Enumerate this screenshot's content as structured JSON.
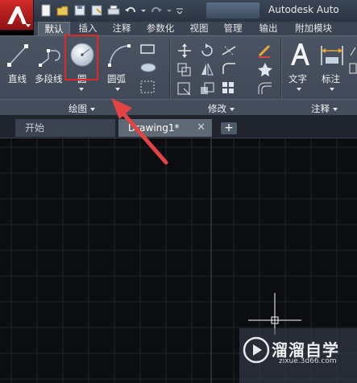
{
  "title_bar": {
    "app_title": "Autodesk Auto"
  },
  "ribbon_tabs": [
    "默认",
    "插入",
    "注释",
    "参数化",
    "视图",
    "管理",
    "输出",
    "附加模块"
  ],
  "ribbon": {
    "draw": {
      "line": "直线",
      "polyline": "多段线",
      "circle": "圆",
      "arc": "圆弧",
      "panel_title": "绘图"
    },
    "modify": {
      "panel_title": "修改"
    },
    "annotation": {
      "text": "文字",
      "dimension": "标注",
      "panel_title": "注释"
    }
  },
  "doc_tabs": {
    "start": "开始",
    "drawing": "Drawing1*",
    "close": "✕",
    "new": "+"
  },
  "watermark": {
    "brand": "溜溜自学",
    "url": "zixue.3d66.com"
  },
  "colors": {
    "highlight": "#e02828",
    "arrow": "#e54343",
    "app_button": "#c0201f"
  }
}
